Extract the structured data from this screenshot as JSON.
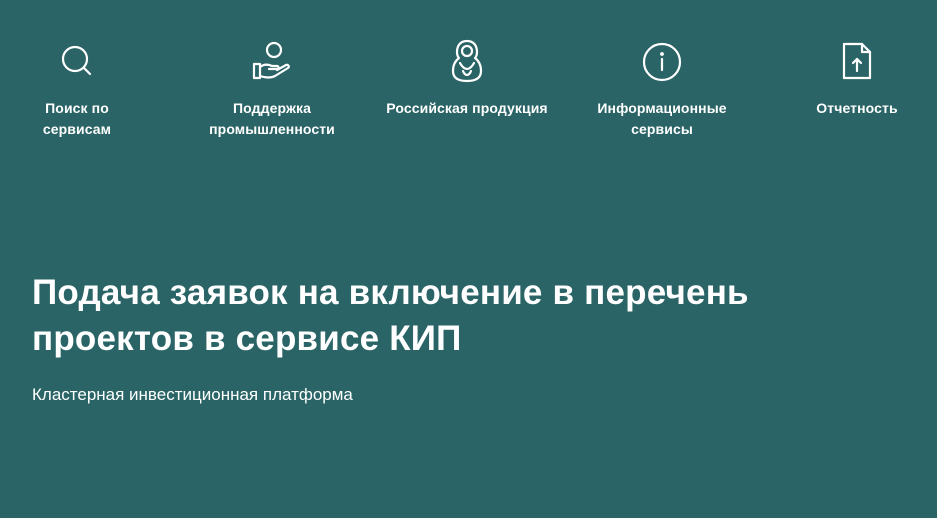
{
  "nav": {
    "items": [
      {
        "icon": "search-icon",
        "label_line1": "Поиск по",
        "label_line2": "сервисам"
      },
      {
        "icon": "hand-support-icon",
        "label_line1": "Поддержка",
        "label_line2": "промышленности"
      },
      {
        "icon": "matryoshka-icon",
        "label_line1": "Российская продукция",
        "label_line2": ""
      },
      {
        "icon": "info-icon",
        "label_line1": "Информационные",
        "label_line2": "сервисы"
      },
      {
        "icon": "document-upload-icon",
        "label_line1": "Отчетность",
        "label_line2": ""
      }
    ]
  },
  "hero": {
    "title_line1": "Подача заявок на включение в перечень",
    "title_line2": "проектов в сервисе КИП",
    "subtitle": "Кластерная инвестиционная платформа"
  },
  "colors": {
    "background": "#2a6466",
    "text": "#ffffff"
  }
}
